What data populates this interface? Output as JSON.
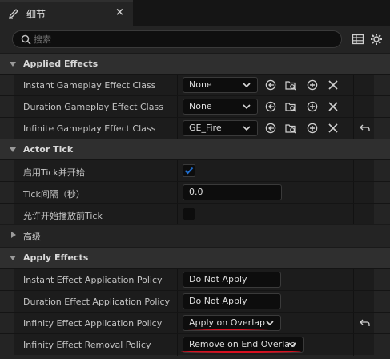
{
  "tab": {
    "title": "细节",
    "close": "×",
    "icon": "pencil-icon"
  },
  "search": {
    "placeholder": "搜索",
    "value": ""
  },
  "toolbar": {
    "icons": [
      "table-view-icon",
      "settings-gear-icon"
    ]
  },
  "categories": {
    "applied_effects": {
      "label": "Applied Effects",
      "rows": [
        {
          "name": "Instant Gameplay Effect Class",
          "value": "None",
          "reset": false
        },
        {
          "name": "Duration Gameplay Effect Class",
          "value": "None",
          "reset": false
        },
        {
          "name": "Infinite Gameplay Effect Class",
          "value": "GE_Fire",
          "reset": true,
          "highlight": true
        }
      ]
    },
    "actor_tick": {
      "label": "Actor Tick",
      "rows": [
        {
          "name": "启用Tick并开始",
          "checked": true
        },
        {
          "name": "Tick间隔（秒）",
          "value": "0.0"
        },
        {
          "name": "允许开始播放前Tick",
          "checked": false
        }
      ]
    },
    "advanced": {
      "label": "高级",
      "expanded": false
    },
    "apply_effects": {
      "label": "Apply Effects",
      "rows": [
        {
          "name": "Instant Effect Application Policy",
          "value": "Do Not Apply",
          "reset": false
        },
        {
          "name": "Duration Effect Application Policy",
          "value": "Do Not Apply",
          "reset": false
        },
        {
          "name": "Infinity Effect Application Policy",
          "value": "Apply on Overlap",
          "reset": true,
          "highlight": true
        },
        {
          "name": "Infinity Effect Removal Policy",
          "value": "Remove on End Overlap",
          "reset": false,
          "highlight": true
        }
      ]
    }
  },
  "asset_actions": [
    "browse-to-asset-icon",
    "find-in-browser-icon",
    "add-icon",
    "clear-icon"
  ],
  "colors": {
    "annotation": "#d81020",
    "checkbox_accent": "#1f6fd1"
  }
}
